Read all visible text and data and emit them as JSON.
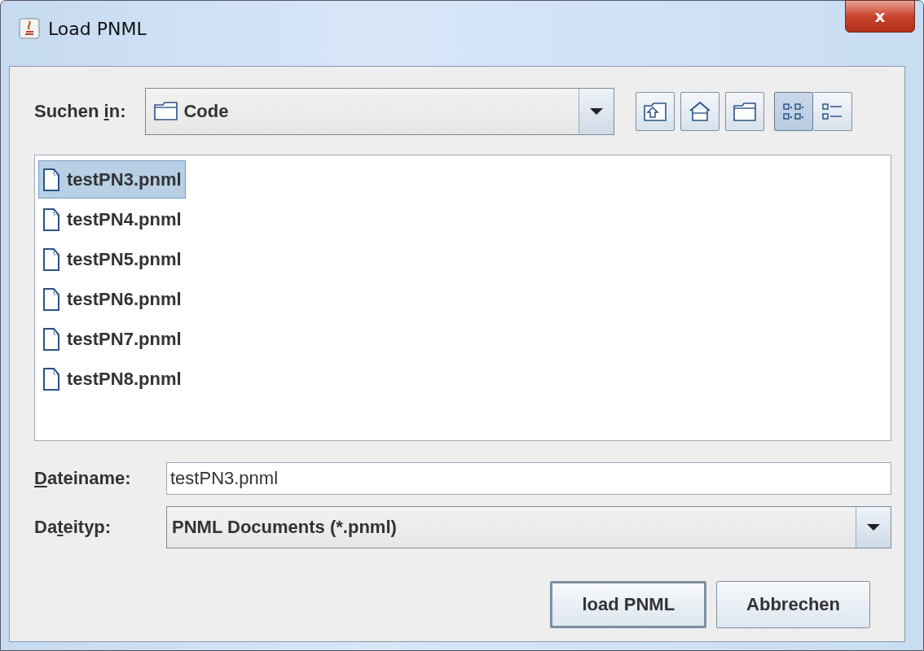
{
  "window": {
    "title": "Load PNML",
    "close": "x"
  },
  "look_in": {
    "label": {
      "before": "Suchen ",
      "mnemonic": "i",
      "after": "n:"
    },
    "value": "Code"
  },
  "toolbar": [
    {
      "kind": "up",
      "selected": false
    },
    {
      "kind": "home",
      "selected": false
    },
    {
      "kind": "newfolder",
      "selected": false
    },
    {
      "kind": "list",
      "selected": true
    },
    {
      "kind": "details",
      "selected": false
    }
  ],
  "files": [
    {
      "name": "testPN3.pnml",
      "selected": true
    },
    {
      "name": "testPN4.pnml",
      "selected": false
    },
    {
      "name": "testPN5.pnml",
      "selected": false
    },
    {
      "name": "testPN6.pnml",
      "selected": false
    },
    {
      "name": "testPN7.pnml",
      "selected": false
    },
    {
      "name": "testPN8.pnml",
      "selected": false
    }
  ],
  "file_name": {
    "label": {
      "mnemonic": "D",
      "after": "ateiname:"
    },
    "value": "testPN3.pnml"
  },
  "file_type": {
    "label": {
      "before": "Da",
      "mnemonic": "t",
      "after": "eityp:"
    },
    "value": "PNML Documents (*.pnml)"
  },
  "buttons": [
    {
      "label": "load PNML",
      "default": true
    },
    {
      "label": "Abbrechen",
      "default": false
    }
  ]
}
